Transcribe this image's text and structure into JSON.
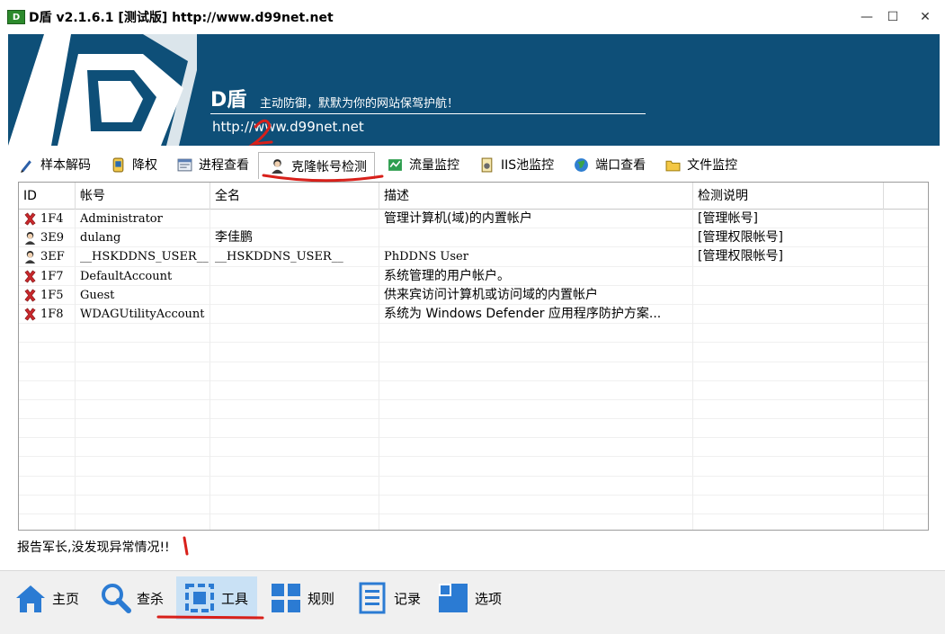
{
  "window": {
    "icon_text": "D",
    "title": "D盾 v2.1.6.1 [测试版] http://www.d99net.net",
    "minimize": "—",
    "maximize": "☐",
    "close": "✕"
  },
  "banner": {
    "brand": "D盾",
    "slogan": "主动防御，默默为你的网站保驾护航！",
    "url": "http://www.d99net.net"
  },
  "tabs": [
    {
      "label": "样本解码",
      "icon": "pen-icon"
    },
    {
      "label": "降权",
      "icon": "shield-badge-icon"
    },
    {
      "label": "进程查看",
      "icon": "window-list-icon"
    },
    {
      "label": "克隆帐号检测",
      "icon": "user-icon",
      "active": true
    },
    {
      "label": "流量监控",
      "icon": "traffic-icon"
    },
    {
      "label": "IIS池监控",
      "icon": "document-gear-icon"
    },
    {
      "label": "端口查看",
      "icon": "globe-icon"
    },
    {
      "label": "文件监控",
      "icon": "folder-icon"
    }
  ],
  "table": {
    "columns": [
      "ID",
      "帐号",
      "全名",
      "描述",
      "检测说明"
    ],
    "rows": [
      {
        "icon": "red-x-icon",
        "id": "1F4",
        "account": "Administrator",
        "fullname": "",
        "desc": "管理计算机(域)的内置帐户",
        "note": "[管理帐号]"
      },
      {
        "icon": "user-icon",
        "id": "3E9",
        "account": "dulang",
        "fullname": "李佳鹏",
        "desc": "",
        "note": "[管理权限帐号]"
      },
      {
        "icon": "user-icon",
        "id": "3EF",
        "account": "__HSKDDNS_USER__",
        "fullname": "__HSKDDNS_USER__",
        "desc": "PhDDNS User",
        "note": "[管理权限帐号]"
      },
      {
        "icon": "red-x-icon",
        "id": "1F7",
        "account": "DefaultAccount",
        "fullname": "",
        "desc": "系统管理的用户帐户。",
        "note": ""
      },
      {
        "icon": "red-x-icon",
        "id": "1F5",
        "account": "Guest",
        "fullname": "",
        "desc": "供来宾访问计算机或访问域的内置帐户",
        "note": ""
      },
      {
        "icon": "red-x-icon",
        "id": "1F8",
        "account": "WDAGUtilityAccount",
        "fullname": "",
        "desc": "系统为 Windows Defender 应用程序防护方案...",
        "note": ""
      }
    ]
  },
  "status": "报告军长,没发现异常情况!!",
  "bottom_nav": [
    {
      "label": "主页",
      "icon": "home-icon"
    },
    {
      "label": "查杀",
      "icon": "search-icon"
    },
    {
      "label": "工具",
      "icon": "tools-icon",
      "active": true
    },
    {
      "label": "规则",
      "icon": "grid-icon"
    },
    {
      "label": "记录",
      "icon": "log-icon"
    },
    {
      "label": "选项",
      "icon": "options-icon"
    }
  ],
  "colors": {
    "banner": "#0e4f78",
    "active_nav": "#c9e1f5",
    "annotation": "#d8201a",
    "error_icon": "#c8282c"
  }
}
